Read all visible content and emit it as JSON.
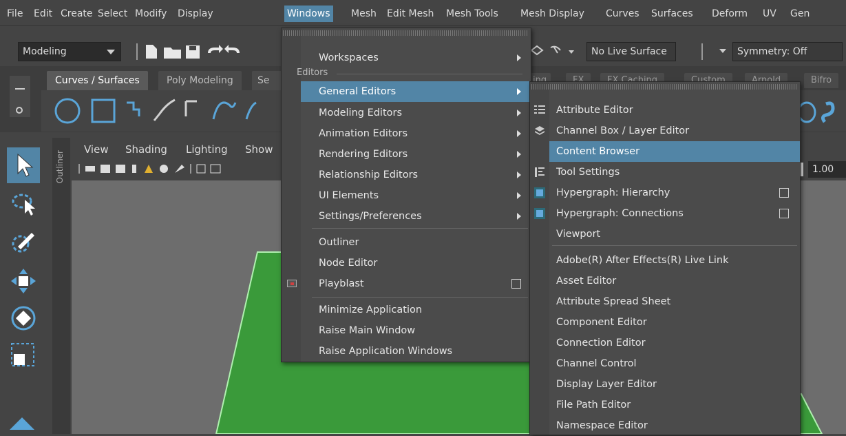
{
  "menubar": {
    "items": [
      "File",
      "Edit",
      "Create",
      "Select",
      "Modify",
      "Display",
      "Windows",
      "Mesh",
      "Edit Mesh",
      "Mesh Tools",
      "Mesh Display",
      "Curves",
      "Surfaces",
      "Deform",
      "UV",
      "Gen"
    ],
    "active": "Windows"
  },
  "toolbar": {
    "workspace": "Modeling",
    "live_surface": "No Live Surface",
    "symmetry": "Symmetry: Off"
  },
  "shelf": {
    "tabs": [
      "Curves / Surfaces",
      "Poly Modeling",
      "Se"
    ],
    "right_tabs": [
      "ing",
      "FX",
      "FX Caching",
      "Custom",
      "Arnold",
      "Bifro"
    ]
  },
  "outliner_label": "Outliner",
  "viewport": {
    "menus": [
      "View",
      "Shading",
      "Lighting",
      "Show"
    ],
    "field_value": "1.00"
  },
  "windows_menu": {
    "workspaces": "Workspaces",
    "editors_header": "Editors",
    "items": [
      {
        "label": "General Editors",
        "submenu": true,
        "highlighted": true
      },
      {
        "label": "Modeling Editors",
        "submenu": true
      },
      {
        "label": "Animation Editors",
        "submenu": true
      },
      {
        "label": "Rendering Editors",
        "submenu": true
      },
      {
        "label": "Relationship Editors",
        "submenu": true
      },
      {
        "label": "UI Elements",
        "submenu": true
      },
      {
        "label": "Settings/Preferences",
        "submenu": true
      }
    ],
    "group2": [
      "Outliner",
      "Node Editor",
      "Playblast"
    ],
    "group3": [
      "Minimize Application",
      "Raise Main Window",
      "Raise Application Windows"
    ]
  },
  "general_editors_menu": {
    "items": [
      {
        "label": "Attribute Editor"
      },
      {
        "label": "Channel Box / Layer Editor"
      },
      {
        "label": "Content Browser",
        "highlighted": true
      },
      {
        "label": "Tool Settings"
      },
      {
        "label": "Hypergraph: Hierarchy",
        "checkbox": true
      },
      {
        "label": "Hypergraph: Connections",
        "checkbox": true
      },
      {
        "label": "Viewport"
      }
    ],
    "group2": [
      "Adobe(R) After Effects(R) Live Link",
      "Asset Editor",
      "Attribute Spread Sheet",
      "Component Editor",
      "Connection Editor",
      "Channel Control",
      "Display Layer Editor",
      "File Path Editor",
      "Namespace Editor"
    ]
  },
  "colors": {
    "highlight": "#5285a6",
    "menu_bg": "#4b4b4b",
    "app_bg": "#444444",
    "plane_green": "#3a9a3a"
  }
}
